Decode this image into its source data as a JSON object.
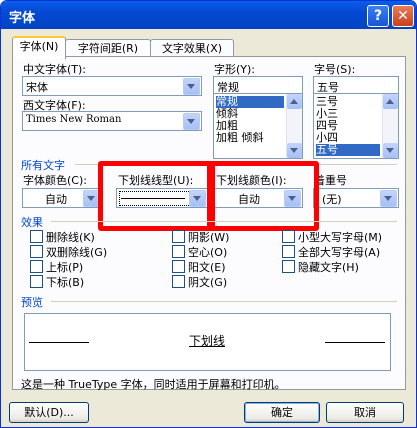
{
  "window": {
    "title": "字体",
    "help": "?",
    "close": "✕"
  },
  "tabs": [
    {
      "label": "字体(N)"
    },
    {
      "label": "字符间距(R)"
    },
    {
      "label": "文字效果(X)"
    }
  ],
  "font": {
    "cn_label": "中文字体(T):",
    "cn_value": "宋体",
    "west_label": "西文字体(F):",
    "west_value": "Times New Roman",
    "style_label": "字形(Y):",
    "style_value": "常规",
    "style_items": [
      "常规",
      "倾斜",
      "加粗",
      "加粗 倾斜"
    ],
    "size_label": "字号(S):",
    "size_value": "五号",
    "size_items": [
      "三号",
      "小三",
      "四号",
      "小四",
      "五号"
    ]
  },
  "all_text": {
    "group_label": "所有文字",
    "color_label": "字体颜色(C):",
    "color_value": "自动",
    "underline_label": "下划线线型(U):",
    "underline_color_label": "下划线颜色(I):",
    "underline_color_value": "自动",
    "emphasis_label": "着重号",
    "emphasis_value": "(无)"
  },
  "effects": {
    "group_label": "效果",
    "items": [
      "删除线(K)",
      "双删除线(G)",
      "上标(P)",
      "下标(B)",
      "阴影(W)",
      "空心(O)",
      "阳文(E)",
      "阴文(G)",
      "小型大写字母(M)",
      "全部大写字母(A)",
      "隐藏文字(H)"
    ]
  },
  "preview": {
    "group_label": "预览",
    "sample": "下划线"
  },
  "info": "这是一种 TrueType 字体，同时适用于屏幕和打印机。",
  "buttons": {
    "default": "默认(D)...",
    "ok": "确定",
    "cancel": "取消"
  },
  "colors": {
    "title_bar": "#0548d4",
    "selection": "#316ac5",
    "group_text": "#0046d5",
    "annotation": "#ff0000"
  }
}
